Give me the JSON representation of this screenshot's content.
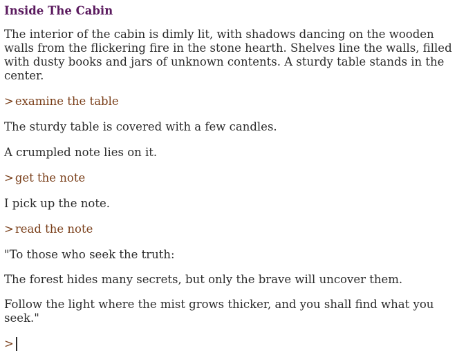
{
  "room": {
    "title": "Inside The Cabin",
    "description": "The interior of the cabin is dimly lit, with shadows dancing on the wooden walls from the flickering fire in the stone hearth. Shelves line the walls, filled with dusty books and jars of unknown contents. A sturdy table stands in the center."
  },
  "prompt_symbol": ">",
  "entries": [
    {
      "command": "examine the table"
    },
    {
      "text": "The sturdy table is covered with a few candles."
    },
    {
      "text": "A crumpled note lies on it."
    },
    {
      "command": "get the note"
    },
    {
      "text": "I pick up the note."
    },
    {
      "command": "read the note"
    },
    {
      "text": "\"To those who seek the truth:"
    },
    {
      "text": "The forest hides many secrets, but only the brave will uncover them."
    },
    {
      "text": "Follow the light where the mist grows thicker, and you shall find what you seek.\""
    }
  ],
  "input": {
    "value": ""
  },
  "colors": {
    "title": "#5a1a5e",
    "command": "#7a3f1a",
    "text": "#2b2b2b",
    "background": "#ffffff"
  }
}
